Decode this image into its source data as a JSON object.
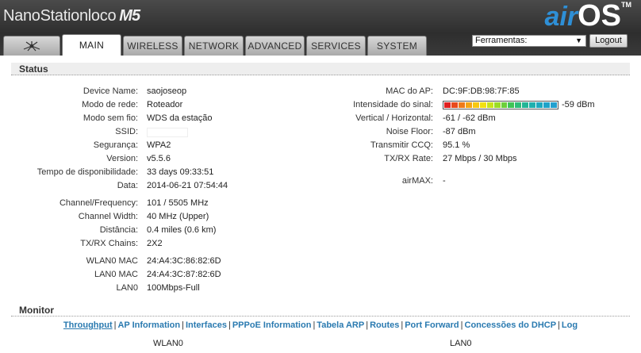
{
  "header": {
    "brand_name": "NanoStation",
    "brand_sub": "loco",
    "brand_model": "M5",
    "logo_air": "air",
    "logo_os": "OS",
    "logo_tm": "TM"
  },
  "tabs": [
    {
      "label": "MAIN",
      "active": true
    },
    {
      "label": "WIRELESS"
    },
    {
      "label": "NETWORK"
    },
    {
      "label": "ADVANCED"
    },
    {
      "label": "SERVICES"
    },
    {
      "label": "SYSTEM"
    }
  ],
  "tools": {
    "selected": "Ferramentas:",
    "logout_label": "Logout"
  },
  "status": {
    "title": "Status",
    "left": [
      {
        "label": "Device Name:",
        "value": "saojoseop"
      },
      {
        "label": "Modo de rede:",
        "value": "Roteador"
      },
      {
        "label": "Modo sem fio:",
        "value": "WDS da estação"
      },
      {
        "label": "SSID:",
        "value": ""
      },
      {
        "label": "Segurança:",
        "value": "WPA2"
      },
      {
        "label": "Version:",
        "value": "v5.5.6"
      },
      {
        "label": "Tempo de disponibilidade:",
        "value": "33 days 09:33:51"
      },
      {
        "label": "Data:",
        "value": "2014-06-21 07:54:44"
      },
      {
        "label": "Channel/Frequency:",
        "value": "101 / 5505 MHz"
      },
      {
        "label": "Channel Width:",
        "value": "40 MHz (Upper)"
      },
      {
        "label": "Distância:",
        "value": "0.4 miles (0.6 km)"
      },
      {
        "label": "TX/RX Chains:",
        "value": "2X2"
      },
      {
        "label": "WLAN0 MAC",
        "value": "24:A4:3C:86:82:6D"
      },
      {
        "label": "LAN0 MAC",
        "value": "24:A4:3C:87:82:6D"
      },
      {
        "label": "LAN0",
        "value": "100Mbps-Full"
      }
    ],
    "right": [
      {
        "label": "MAC do AP:",
        "value": "DC:9F:DB:98:7F:85"
      },
      {
        "label": "Intensidade do sinal:",
        "value": "-59 dBm"
      },
      {
        "label": "Vertical / Horizontal:",
        "value": "-61 / -62 dBm"
      },
      {
        "label": "Noise Floor:",
        "value": "-87 dBm"
      },
      {
        "label": "Transmitir CCQ:",
        "value": "95.1 %"
      },
      {
        "label": "TX/RX Rate:",
        "value": "27 Mbps / 30 Mbps"
      },
      {
        "label": "airMAX:",
        "value": "-"
      }
    ],
    "signal_colors": [
      "#e02020",
      "#e84a1c",
      "#ef7a18",
      "#f5a514",
      "#f7c812",
      "#f2e012",
      "#c9e31a",
      "#9bdc26",
      "#6ccf3a",
      "#3fc455",
      "#2ebd78",
      "#22b596",
      "#1fb0ae",
      "#1ea9bf",
      "#1fa3c9",
      "#22a0cf"
    ]
  },
  "monitor": {
    "title": "Monitor",
    "links": [
      "Throughput",
      "AP Information",
      "Interfaces",
      "PPPoE Information",
      "Tabela ARP",
      "Routes",
      "Port Forward",
      "Concessões do DHCP",
      "Log"
    ],
    "iface_left": "WLAN0",
    "iface_right": "LAN0"
  }
}
